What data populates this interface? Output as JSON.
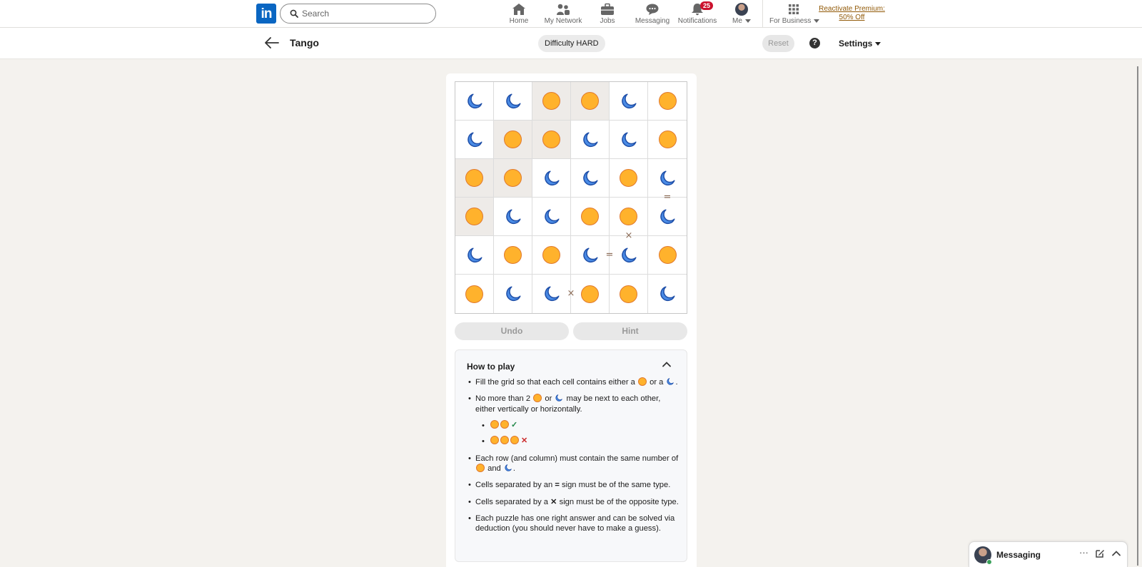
{
  "nav": {
    "logo": "in",
    "search_placeholder": "Search",
    "items": [
      {
        "label": "Home",
        "icon": "home-icon"
      },
      {
        "label": "My Network",
        "icon": "network-icon"
      },
      {
        "label": "Jobs",
        "icon": "briefcase-icon"
      },
      {
        "label": "Messaging",
        "icon": "chat-icon"
      },
      {
        "label": "Notifications",
        "icon": "bell-icon",
        "badge": "25"
      },
      {
        "label": "Me",
        "icon": "avatar"
      },
      {
        "label": "For Business",
        "icon": "grid-icon"
      }
    ],
    "premium": "Reactivate Premium: 50% Off"
  },
  "header": {
    "title": "Tango",
    "difficulty": "Difficulty HARD",
    "reset": "Reset",
    "help": "?",
    "settings": "Settings"
  },
  "board": {
    "size": 6,
    "grid": [
      [
        "moon",
        "moon",
        "sun",
        "sun",
        "moon",
        "sun"
      ],
      [
        "moon",
        "sun",
        "sun",
        "moon",
        "moon",
        "sun"
      ],
      [
        "sun",
        "sun",
        "moon",
        "moon",
        "sun",
        "moon"
      ],
      [
        "sun",
        "moon",
        "moon",
        "sun",
        "sun",
        "moon"
      ],
      [
        "moon",
        "sun",
        "sun",
        "moon",
        "moon",
        "sun"
      ],
      [
        "sun",
        "moon",
        "moon",
        "sun",
        "sun",
        "moon"
      ]
    ],
    "locked": [
      [
        0,
        2
      ],
      [
        0,
        3
      ],
      [
        1,
        1
      ],
      [
        1,
        2
      ],
      [
        2,
        0
      ],
      [
        2,
        1
      ],
      [
        3,
        0
      ]
    ],
    "constraints": [
      {
        "type": "=",
        "between": [
          [
            2,
            5
          ],
          [
            3,
            5
          ]
        ]
      },
      {
        "type": "×",
        "between": [
          [
            3,
            4
          ],
          [
            4,
            4
          ]
        ]
      },
      {
        "type": "=",
        "between": [
          [
            4,
            3
          ],
          [
            4,
            4
          ]
        ]
      },
      {
        "type": "×",
        "between": [
          [
            5,
            2
          ],
          [
            5,
            3
          ]
        ]
      }
    ]
  },
  "controls": {
    "undo": "Undo",
    "hint": "Hint"
  },
  "howto": {
    "title": "How to play",
    "rule1_a": "Fill the grid so that each cell contains either a",
    "rule1_b": "or a",
    "rule1_c": ".",
    "rule2_a": "No more than 2",
    "rule2_b": "or",
    "rule2_c": "may be next to each other, either vertically or horizontally.",
    "ok_mark": "✓",
    "bad_mark": "✕",
    "rule3_a": "Each row (and column) must contain the same number of",
    "rule3_b": "and",
    "rule3_c": ".",
    "rule4_a": "Cells separated by an",
    "rule4_sign": "=",
    "rule4_b": "sign must be of the same type.",
    "rule5_a": "Cells separated by a",
    "rule5_sign": "✕",
    "rule5_b": "sign must be of the opposite type.",
    "rule6": "Each puzzle has one right answer and can be solved via deduction (you should never have to make a guess)."
  },
  "messaging": {
    "label": "Messaging",
    "more": "···"
  },
  "colors": {
    "brand": "#0a66c2",
    "sun_fill": "#ffb22c",
    "sun_stroke": "#e0792e",
    "moon_fill": "#4a8be5",
    "moon_stroke": "#1f4fa8",
    "locked_cell": "#eeebe8",
    "badge": "#cb112d",
    "premium": "#915907"
  }
}
